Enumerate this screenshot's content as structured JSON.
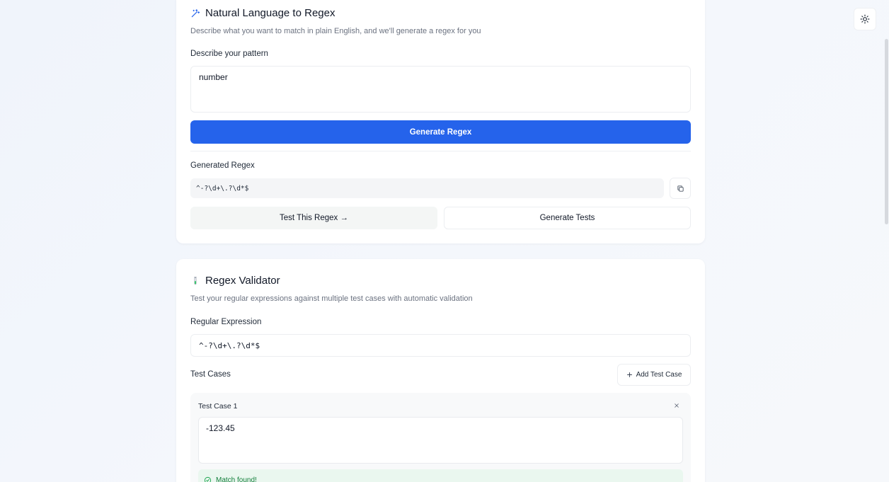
{
  "nl_card": {
    "title": "Natural Language to Regex",
    "subtitle": "Describe what you want to match in plain English, and we'll generate a regex for you",
    "describe_label": "Describe your pattern",
    "describe_value": "number",
    "generate_button": "Generate Regex",
    "generated_label": "Generated Regex",
    "generated_regex": "^-?\\d+\\.?\\d*$",
    "test_button": "Test This Regex →",
    "generate_tests_button": "Generate Tests"
  },
  "validator_card": {
    "title": "Regex Validator",
    "subtitle": "Test your regular expressions against multiple test cases with automatic validation",
    "regex_label": "Regular Expression",
    "regex_value": "^-?\\d+\\.?\\d*$",
    "test_cases_label": "Test Cases",
    "add_test_case_button": "Add Test Case",
    "test_cases": [
      {
        "label": "Test Case 1",
        "value": "-123.45",
        "result": "Match found!"
      }
    ]
  },
  "colors": {
    "primary": "#2563eb",
    "success_text": "#15803d",
    "success_bg": "#eaf7ef"
  },
  "icons": {
    "theme_toggle": "sun-icon",
    "nl_title": "magic-wand-icon",
    "validator_title": "test-tube-icon",
    "copy": "copy-icon",
    "add": "plus-icon",
    "remove": "close-icon",
    "success": "check-circle-icon"
  }
}
